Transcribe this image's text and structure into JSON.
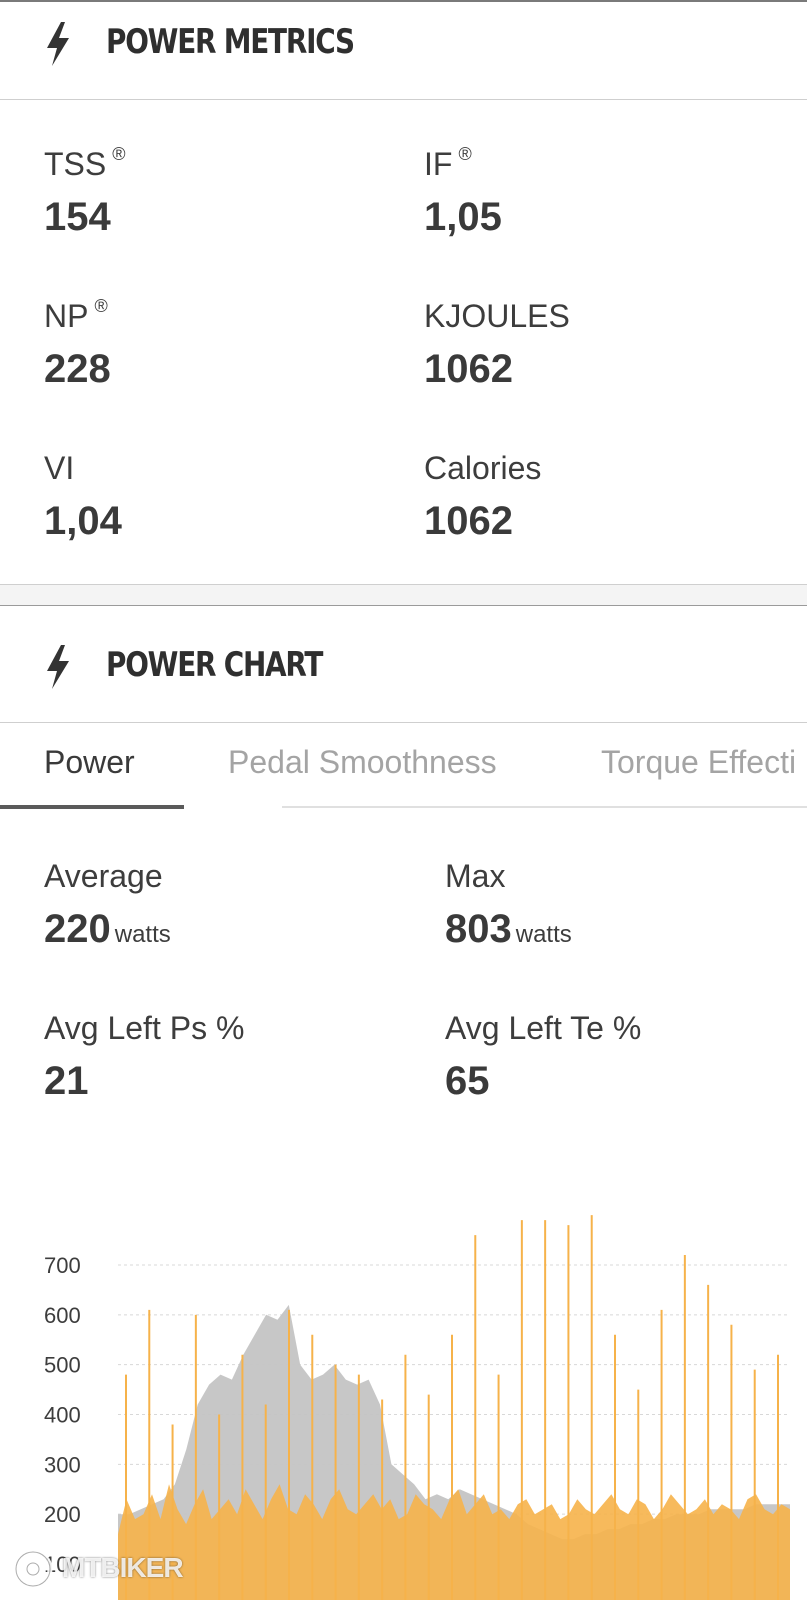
{
  "power_metrics": {
    "title": "POWER METRICS",
    "icon": "bolt-icon",
    "items": [
      {
        "label": "TSS",
        "sup": "®",
        "value": "154"
      },
      {
        "label": "IF",
        "sup": "®",
        "value": "1,05"
      },
      {
        "label": "NP",
        "sup": "®",
        "value": "228"
      },
      {
        "label": "KJOULES",
        "sup": "",
        "value": "1062"
      },
      {
        "label": "VI",
        "sup": "",
        "value": "1,04"
      },
      {
        "label": "Calories",
        "sup": "",
        "value": "1062"
      }
    ]
  },
  "power_chart": {
    "title": "POWER CHART",
    "icon": "bolt-icon",
    "tabs": [
      {
        "label": "Power",
        "active": true
      },
      {
        "label": "Pedal Smoothness",
        "active": false
      },
      {
        "label": "Torque Effecti",
        "active": false
      }
    ],
    "stats": [
      {
        "label": "Average",
        "value": "220",
        "unit": "watts"
      },
      {
        "label": "Max",
        "value": "803",
        "unit": "watts"
      },
      {
        "label": "Avg Left Ps %",
        "value": "21",
        "unit": ""
      },
      {
        "label": "Avg Left Te %",
        "value": "65",
        "unit": ""
      }
    ]
  },
  "chart_data": {
    "type": "area",
    "y_ticks": [
      "700",
      "600",
      "500",
      "400",
      "300",
      "200",
      "100"
    ],
    "ylim": [
      0,
      800
    ],
    "grid": true,
    "colors": {
      "power": "#f6b24a",
      "elevation": "#c4c4c4",
      "grid": "#d8d8d8"
    },
    "series": [
      {
        "values": [
          160,
          230,
          190,
          200,
          240,
          190,
          260,
          210,
          180,
          220,
          250,
          190,
          210,
          230,
          200,
          250,
          220,
          190,
          230,
          260,
          210,
          200,
          240,
          220,
          190,
          230,
          250,
          210,
          200,
          220,
          240,
          210,
          230,
          190,
          200,
          240,
          220,
          210,
          190,
          230,
          250,
          200,
          220,
          240,
          200,
          210,
          190,
          220,
          230,
          200,
          210,
          220,
          190,
          200,
          230,
          210,
          200,
          220,
          240,
          210,
          200,
          230,
          220,
          190,
          210,
          240,
          220,
          200,
          210,
          230,
          200,
          220,
          210,
          190,
          230,
          240,
          210,
          200,
          220,
          210
        ]
      },
      {
        "values": [
          200,
          200,
          210,
          220,
          230,
          260,
          330,
          420,
          460,
          480,
          470,
          520,
          560,
          600,
          590,
          620,
          500,
          470,
          480,
          500,
          470,
          460,
          470,
          420,
          300,
          280,
          260,
          230,
          240,
          230,
          250,
          240,
          230,
          220,
          210,
          200,
          180,
          170,
          160,
          150,
          150,
          160,
          160,
          170,
          170,
          180,
          180,
          190,
          190,
          200,
          200,
          200,
          210,
          210,
          210,
          210,
          220,
          220,
          220,
          220
        ]
      }
    ],
    "spikes": [
      480,
      610,
      380,
      600,
      400,
      520,
      420,
      610,
      560,
      500,
      480,
      430,
      520,
      440,
      560,
      760,
      480,
      790,
      790,
      780,
      800,
      560,
      450,
      610,
      720,
      660,
      580,
      490,
      520
    ]
  }
}
